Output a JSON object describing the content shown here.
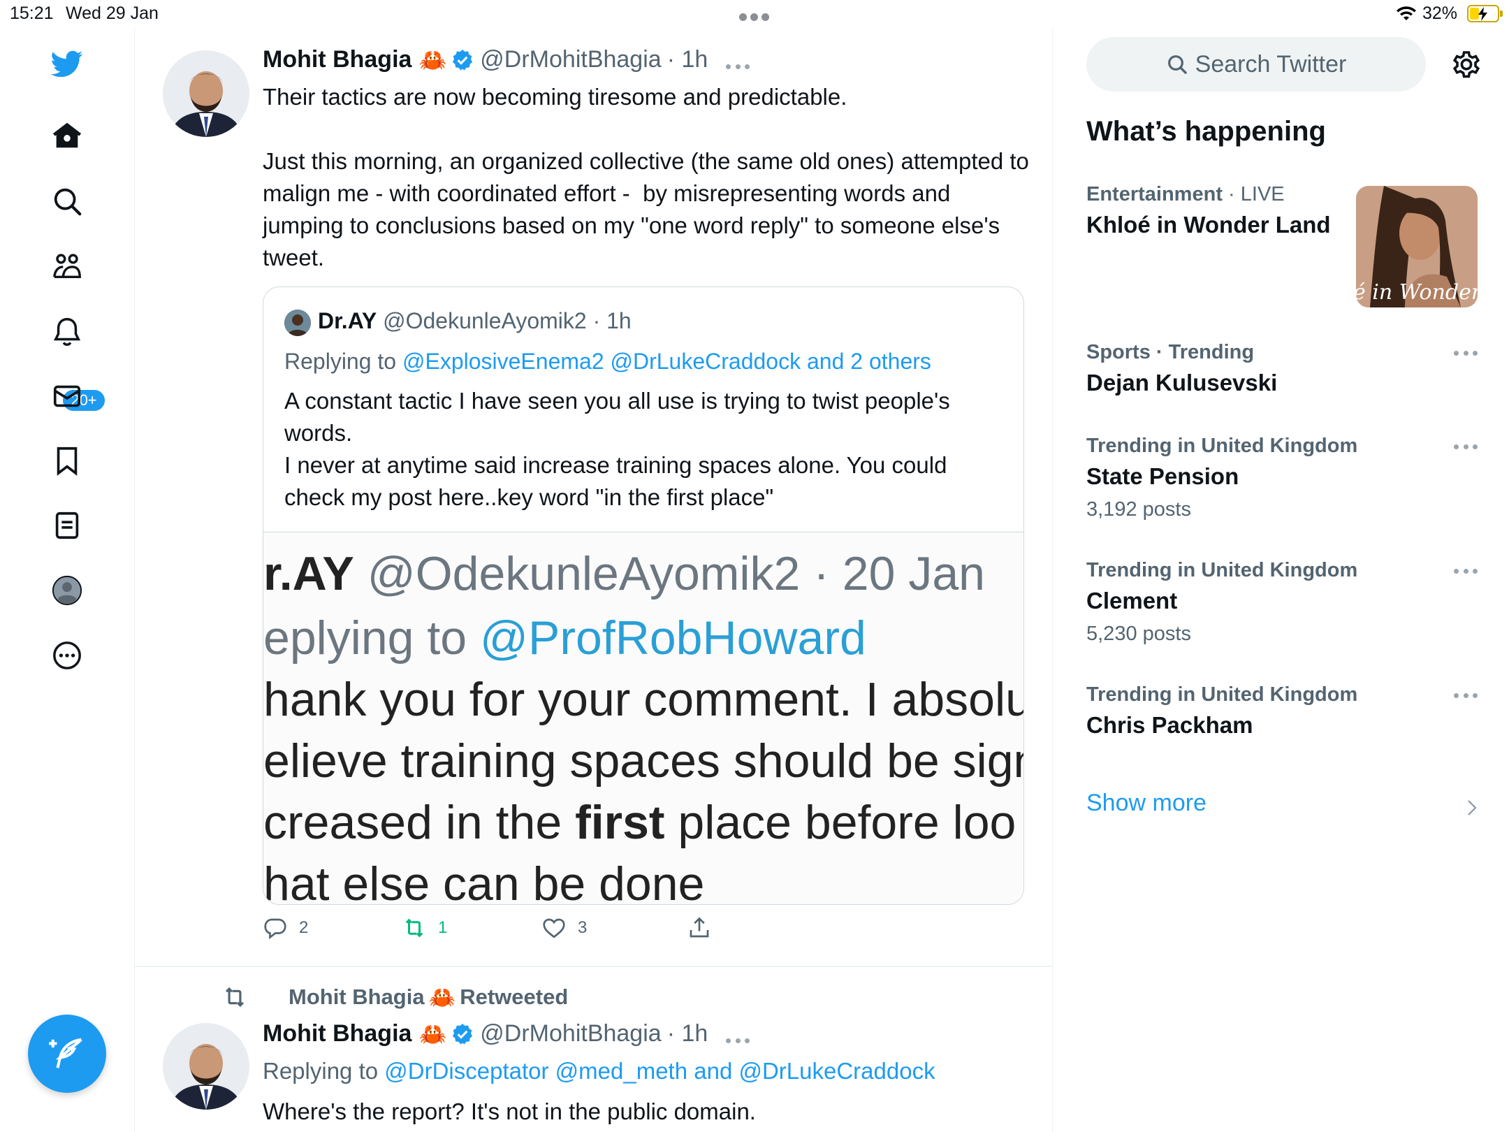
{
  "status_bar": {
    "time": "15:21",
    "date": "Wed 29 Jan",
    "battery": "32%",
    "battery_level": 0.32
  },
  "nav": {
    "notifications_badge": "20+",
    "icons": [
      "twitter-logo-icon",
      "home-icon",
      "search-icon",
      "communities-icon",
      "notifications-icon",
      "messages-icon",
      "bookmarks-icon",
      "lists-icon",
      "profile-icon",
      "more-icon",
      "compose-icon"
    ]
  },
  "tweet1": {
    "name": "Mohit Bhagia",
    "emoji": "🦀",
    "handle": "@DrMohitBhagia",
    "time": "· 1h",
    "text": "Their tactics are now becoming tiresome and predictable.\n\nJust this morning, an organized collective (the same old ones) attempted to malign me - with coordinated effort -  by misrepresenting words and jumping to conclusions based on my \"one word reply\" to someone else's tweet.",
    "quote": {
      "name": "Dr.AY",
      "handle": "@OdekunleAyomik2",
      "time": "· 1h",
      "replying_prefix": "Replying to ",
      "replying_to": "@ExplosiveEnema2 @DrLukeCraddock and 2 others",
      "text": "A constant tactic I have seen you all use is trying to twist people's words.\nI never at anytime said increase training spaces alone. You could check my post here..key word \"in the first place\"",
      "image": {
        "line1_name": "r.AY",
        "line1_rest": " @OdekunleAyomik2 · 20 Jan",
        "line2_prefix": "eplying to ",
        "line2_link": "@ProfRobHoward",
        "line3": "hank you for your comment. I absolu",
        "line4": "elieve training spaces should be sign",
        "line5_pre": "creased in the ",
        "line5_bold": "first",
        "line5_post": " place before loo",
        "line6": "hat else can be done"
      }
    },
    "replies": "2",
    "retweets": "1",
    "likes": "3"
  },
  "tweet2": {
    "retweeted_by": "Mohit Bhagia",
    "retweeted_emoji": "🦀",
    "retweeted_label": "Retweeted",
    "name": "Mohit Bhagia",
    "emoji": "🦀",
    "handle": "@DrMohitBhagia",
    "time": "· 1h",
    "replying_prefix": "Replying to ",
    "replying_to": "@DrDisceptator @med_meth and @DrLukeCraddock",
    "text": "Where's the report? It's not in the public domain."
  },
  "sidebar": {
    "search_placeholder": "Search Twitter",
    "heading": "What’s happening",
    "trends": [
      {
        "category": "Entertainment",
        "meta": " · LIVE",
        "title": "Khloé in Wonder Land",
        "count": "",
        "image_text": "é in Wonder L"
      },
      {
        "category": "Sports · Trending",
        "meta": "",
        "title": "Dejan Kulusevski",
        "count": ""
      },
      {
        "category": "Trending in United Kingdom",
        "meta": "",
        "title": "State Pension",
        "count": "3,192 posts"
      },
      {
        "category": "Trending in United Kingdom",
        "meta": "",
        "title": "Clement",
        "count": "5,230 posts"
      },
      {
        "category": "Trending in United Kingdom",
        "meta": "",
        "title": "Chris Packham",
        "count": ""
      }
    ],
    "show_more": "Show more"
  },
  "colors": {
    "accent": "#1d9bf0",
    "retweet_green": "#00ba7c",
    "muted": "#536471"
  }
}
